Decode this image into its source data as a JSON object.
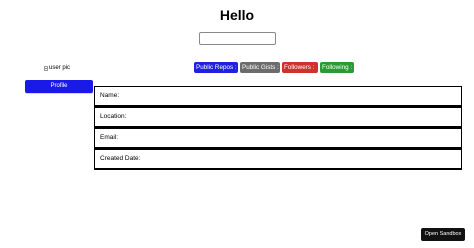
{
  "header": {
    "title": "Hello"
  },
  "search": {
    "value": "",
    "placeholder": ""
  },
  "profile": {
    "avatar_alt": "user pic",
    "button_label": "Profile"
  },
  "badges": [
    {
      "label": "Public Repos :",
      "color": "#2020e0"
    },
    {
      "label": "Public Gists :",
      "color": "#6c6c6c"
    },
    {
      "label": "Followers :",
      "color": "#d03030"
    },
    {
      "label": "Following :",
      "color": "#2a9a35"
    }
  ],
  "info": [
    {
      "label": "Name:"
    },
    {
      "label": "Location:"
    },
    {
      "label": "Email:"
    },
    {
      "label": "Created Date:"
    }
  ],
  "footer": {
    "sandbox_label": "Open Sandbox"
  }
}
